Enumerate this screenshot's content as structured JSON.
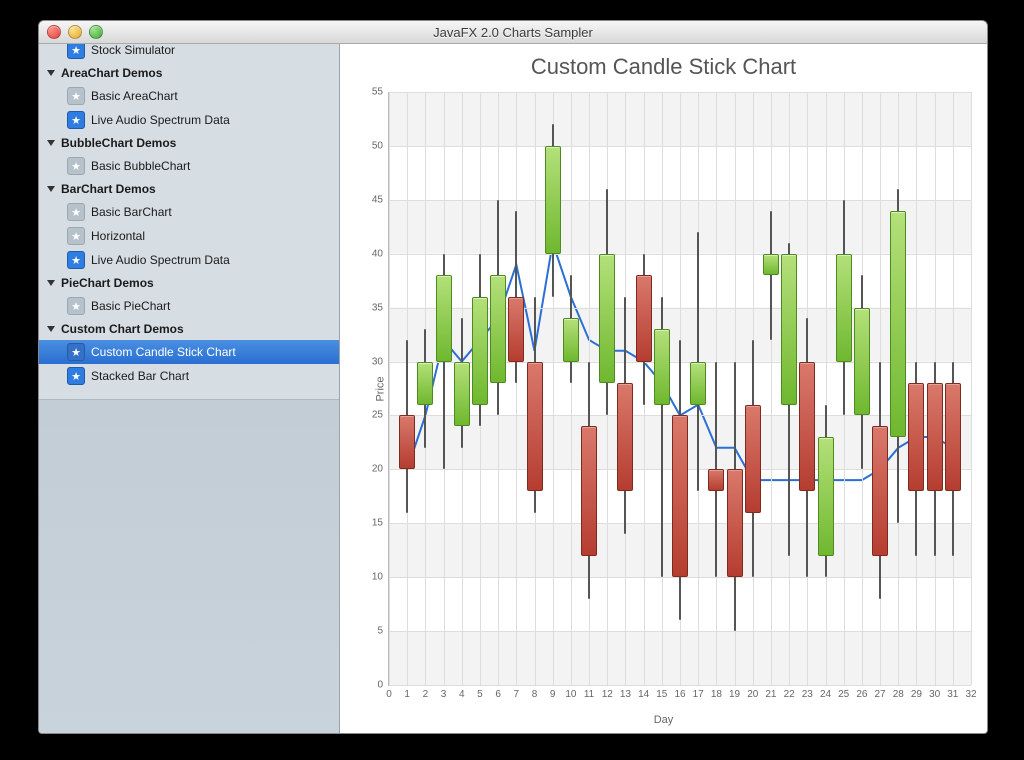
{
  "window": {
    "title": "JavaFX 2.0 Charts Sampler"
  },
  "sidebar": {
    "partial_top_item": "Stock Simulator",
    "groups": [
      {
        "label": "AreaChart Demos",
        "items": [
          {
            "label": "Basic AreaChart",
            "fav": false
          },
          {
            "label": "Live Audio Spectrum Data",
            "fav": true
          }
        ]
      },
      {
        "label": "BubbleChart Demos",
        "items": [
          {
            "label": "Basic BubbleChart",
            "fav": false
          }
        ]
      },
      {
        "label": "BarChart Demos",
        "items": [
          {
            "label": "Basic BarChart",
            "fav": false
          },
          {
            "label": "Horizontal",
            "fav": false
          },
          {
            "label": "Live Audio Spectrum Data",
            "fav": true
          }
        ]
      },
      {
        "label": "PieChart Demos",
        "items": [
          {
            "label": "Basic PieChart",
            "fav": false
          }
        ]
      },
      {
        "label": "Custom Chart Demos",
        "items": [
          {
            "label": "Custom Candle Stick Chart",
            "fav": true,
            "selected": true
          },
          {
            "label": "Stacked Bar Chart",
            "fav": true
          }
        ]
      }
    ]
  },
  "chart_data": {
    "type": "candlestick",
    "title": "Custom Candle Stick Chart",
    "xlabel": "Day",
    "ylabel": "Price",
    "xlim": [
      0,
      32
    ],
    "ylim": [
      0,
      55
    ],
    "xticks": [
      0,
      1,
      2,
      3,
      4,
      5,
      6,
      7,
      8,
      9,
      10,
      11,
      12,
      13,
      14,
      15,
      16,
      17,
      18,
      19,
      20,
      21,
      22,
      23,
      24,
      25,
      26,
      27,
      28,
      29,
      30,
      31,
      32
    ],
    "yticks": [
      0,
      5,
      10,
      15,
      20,
      25,
      30,
      35,
      40,
      45,
      50,
      55
    ],
    "series": [
      {
        "x": 1,
        "open": 25,
        "close": 20,
        "high": 32,
        "low": 16,
        "avg": 20
      },
      {
        "x": 2,
        "open": 26,
        "close": 30,
        "high": 33,
        "low": 22,
        "avg": 25
      },
      {
        "x": 3,
        "open": 30,
        "close": 38,
        "high": 40,
        "low": 20,
        "avg": 32
      },
      {
        "x": 4,
        "open": 24,
        "close": 30,
        "high": 34,
        "low": 22,
        "avg": 30
      },
      {
        "x": 5,
        "open": 26,
        "close": 36,
        "high": 40,
        "low": 24,
        "avg": 32
      },
      {
        "x": 6,
        "open": 28,
        "close": 38,
        "high": 45,
        "low": 25,
        "avg": 34
      },
      {
        "x": 7,
        "open": 36,
        "close": 30,
        "high": 44,
        "low": 28,
        "avg": 39
      },
      {
        "x": 8,
        "open": 30,
        "close": 18,
        "high": 36,
        "low": 16,
        "avg": 31
      },
      {
        "x": 9,
        "open": 40,
        "close": 50,
        "high": 52,
        "low": 36,
        "avg": 41
      },
      {
        "x": 10,
        "open": 30,
        "close": 34,
        "high": 38,
        "low": 28,
        "avg": 36
      },
      {
        "x": 11,
        "open": 24,
        "close": 12,
        "high": 30,
        "low": 8,
        "avg": 32
      },
      {
        "x": 12,
        "open": 28,
        "close": 40,
        "high": 46,
        "low": 25,
        "avg": 31
      },
      {
        "x": 13,
        "open": 28,
        "close": 18,
        "high": 36,
        "low": 14,
        "avg": 31
      },
      {
        "x": 14,
        "open": 38,
        "close": 30,
        "high": 40,
        "low": 26,
        "avg": 30
      },
      {
        "x": 15,
        "open": 26,
        "close": 33,
        "high": 36,
        "low": 10,
        "avg": 28
      },
      {
        "x": 16,
        "open": 25,
        "close": 10,
        "high": 32,
        "low": 6,
        "avg": 25
      },
      {
        "x": 17,
        "open": 26,
        "close": 30,
        "high": 42,
        "low": 18,
        "avg": 26
      },
      {
        "x": 18,
        "open": 20,
        "close": 18,
        "high": 30,
        "low": 10,
        "avg": 22
      },
      {
        "x": 19,
        "open": 20,
        "close": 10,
        "high": 30,
        "low": 5,
        "avg": 22
      },
      {
        "x": 20,
        "open": 26,
        "close": 16,
        "high": 32,
        "low": 10,
        "avg": 19
      },
      {
        "x": 21,
        "open": 38,
        "close": 40,
        "high": 44,
        "low": 32,
        "avg": 19
      },
      {
        "x": 22,
        "open": 26,
        "close": 40,
        "high": 41,
        "low": 12,
        "avg": 19
      },
      {
        "x": 23,
        "open": 30,
        "close": 18,
        "high": 34,
        "low": 10,
        "avg": 19
      },
      {
        "x": 24,
        "open": 12,
        "close": 23,
        "high": 26,
        "low": 10,
        "avg": 19
      },
      {
        "x": 25,
        "open": 30,
        "close": 40,
        "high": 45,
        "low": 25,
        "avg": 19
      },
      {
        "x": 26,
        "open": 25,
        "close": 35,
        "high": 38,
        "low": 20,
        "avg": 19
      },
      {
        "x": 27,
        "open": 24,
        "close": 12,
        "high": 30,
        "low": 8,
        "avg": 20
      },
      {
        "x": 28,
        "open": 23,
        "close": 44,
        "high": 46,
        "low": 15,
        "avg": 22
      },
      {
        "x": 29,
        "open": 28,
        "close": 18,
        "high": 30,
        "low": 12,
        "avg": 23
      },
      {
        "x": 30,
        "open": 28,
        "close": 18,
        "high": 30,
        "low": 12,
        "avg": 23
      },
      {
        "x": 31,
        "open": 28,
        "close": 18,
        "high": 30,
        "low": 12,
        "avg": 22
      }
    ],
    "colors": {
      "up": "#7ec13f",
      "down": "#c04a3a",
      "avg_line": "#2a6fd6"
    }
  }
}
